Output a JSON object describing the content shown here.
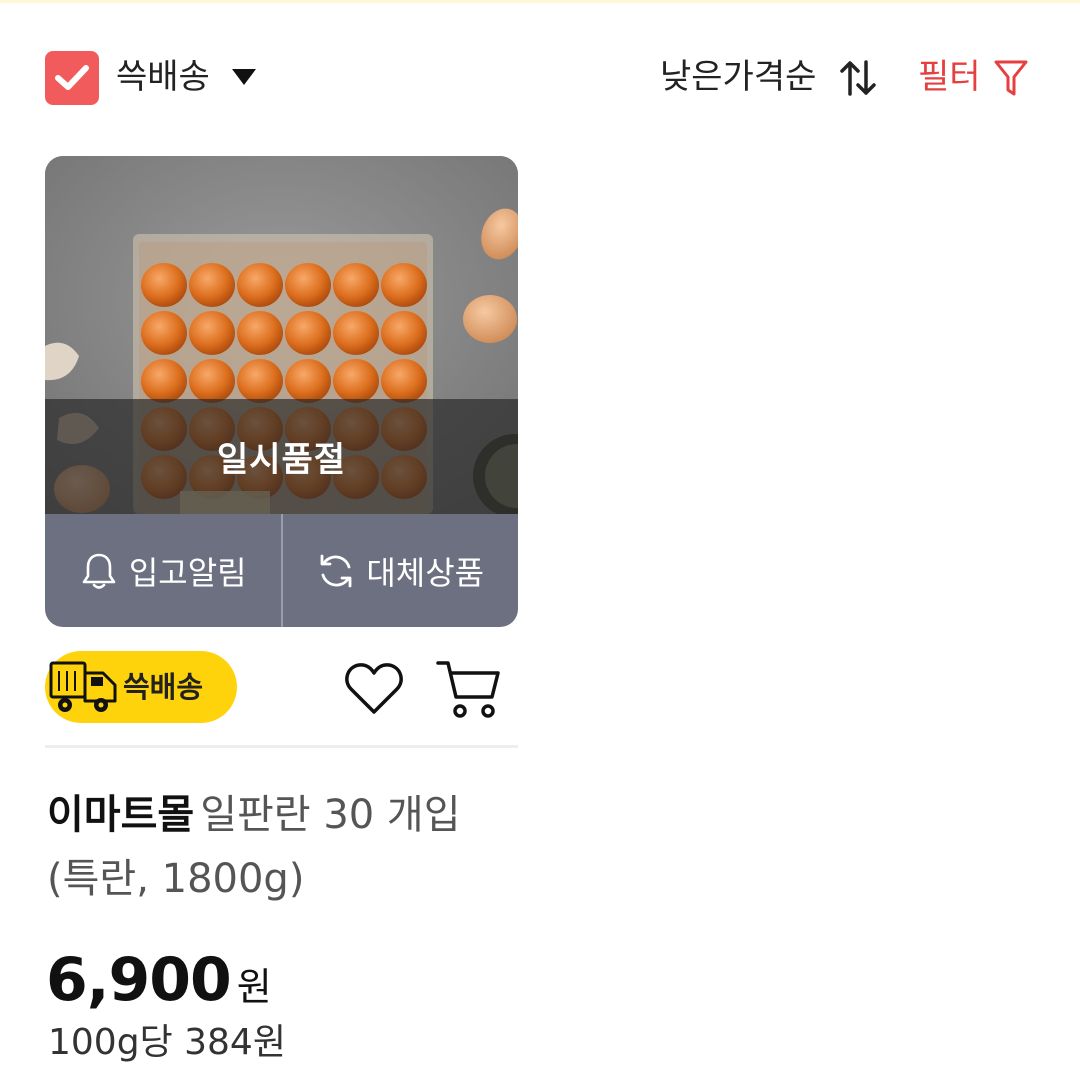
{
  "colors": {
    "accent_red": "#f25b5b",
    "filter_red": "#e5403f",
    "badge_yellow": "#ffd30b",
    "action_bar": "#6d7080"
  },
  "header": {
    "ssg_delivery_filter_label": "쓱배송",
    "sort_label": "낮은가격순",
    "filter_label": "필터"
  },
  "product": {
    "status_overlay": "일시품절",
    "actions": {
      "restock_alert_label": "입고알림",
      "substitute_label": "대체상품"
    },
    "delivery_badge": "쓱배송",
    "brand": "이마트몰",
    "name": "일판란 30 개입 (특란, 1800g)",
    "price": "6,900",
    "price_unit": "원",
    "unit_price": "100g당 384원"
  }
}
